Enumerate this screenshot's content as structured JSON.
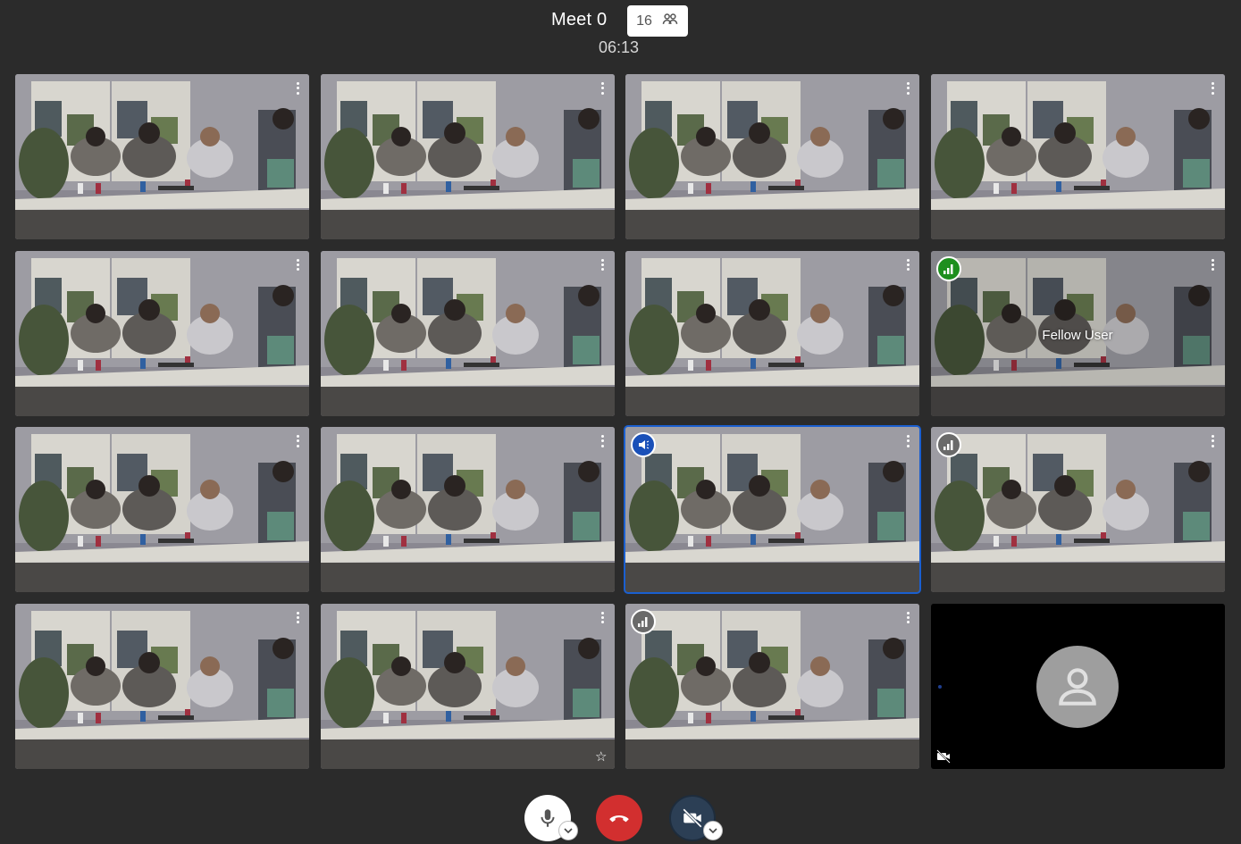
{
  "meeting": {
    "title": "Meet 0",
    "participant_count": "16",
    "timer": "06:13"
  },
  "tiles": [
    {
      "row": 1,
      "col": 1,
      "type": "video"
    },
    {
      "row": 1,
      "col": 2,
      "type": "video"
    },
    {
      "row": 1,
      "col": 3,
      "type": "video"
    },
    {
      "row": 1,
      "col": 4,
      "type": "video"
    },
    {
      "row": 2,
      "col": 1,
      "type": "video"
    },
    {
      "row": 2,
      "col": 2,
      "type": "video"
    },
    {
      "row": 2,
      "col": 3,
      "type": "video"
    },
    {
      "row": 2,
      "col": 4,
      "type": "video",
      "badge": "signal-green-icon",
      "name": "Fellow User"
    },
    {
      "row": 3,
      "col": 1,
      "type": "video"
    },
    {
      "row": 3,
      "col": 2,
      "type": "video"
    },
    {
      "row": 3,
      "col": 3,
      "type": "video",
      "badge": "speaker-blue-icon",
      "active_speaker": true
    },
    {
      "row": 3,
      "col": 4,
      "type": "video",
      "badge": "signal-grey-icon"
    },
    {
      "row": 4,
      "col": 1,
      "type": "video"
    },
    {
      "row": 4,
      "col": 2,
      "type": "video",
      "corner_icon": "star-icon"
    },
    {
      "row": 4,
      "col": 3,
      "type": "video",
      "badge": "signal-grey-icon"
    },
    {
      "row": 4,
      "col": 4,
      "type": "camera-off",
      "icon": "avatar-placeholder-icon"
    }
  ],
  "controls": {
    "mic": "microphone-icon",
    "hangup": "hang-up-icon",
    "camera": "camera-off-icon"
  },
  "colors": {
    "background": "#2b2b2b",
    "active_border": "#1a5fd0",
    "hangup": "#d22f2f",
    "signal_good": "#1e8f1e",
    "speaker": "#1a50b8"
  }
}
